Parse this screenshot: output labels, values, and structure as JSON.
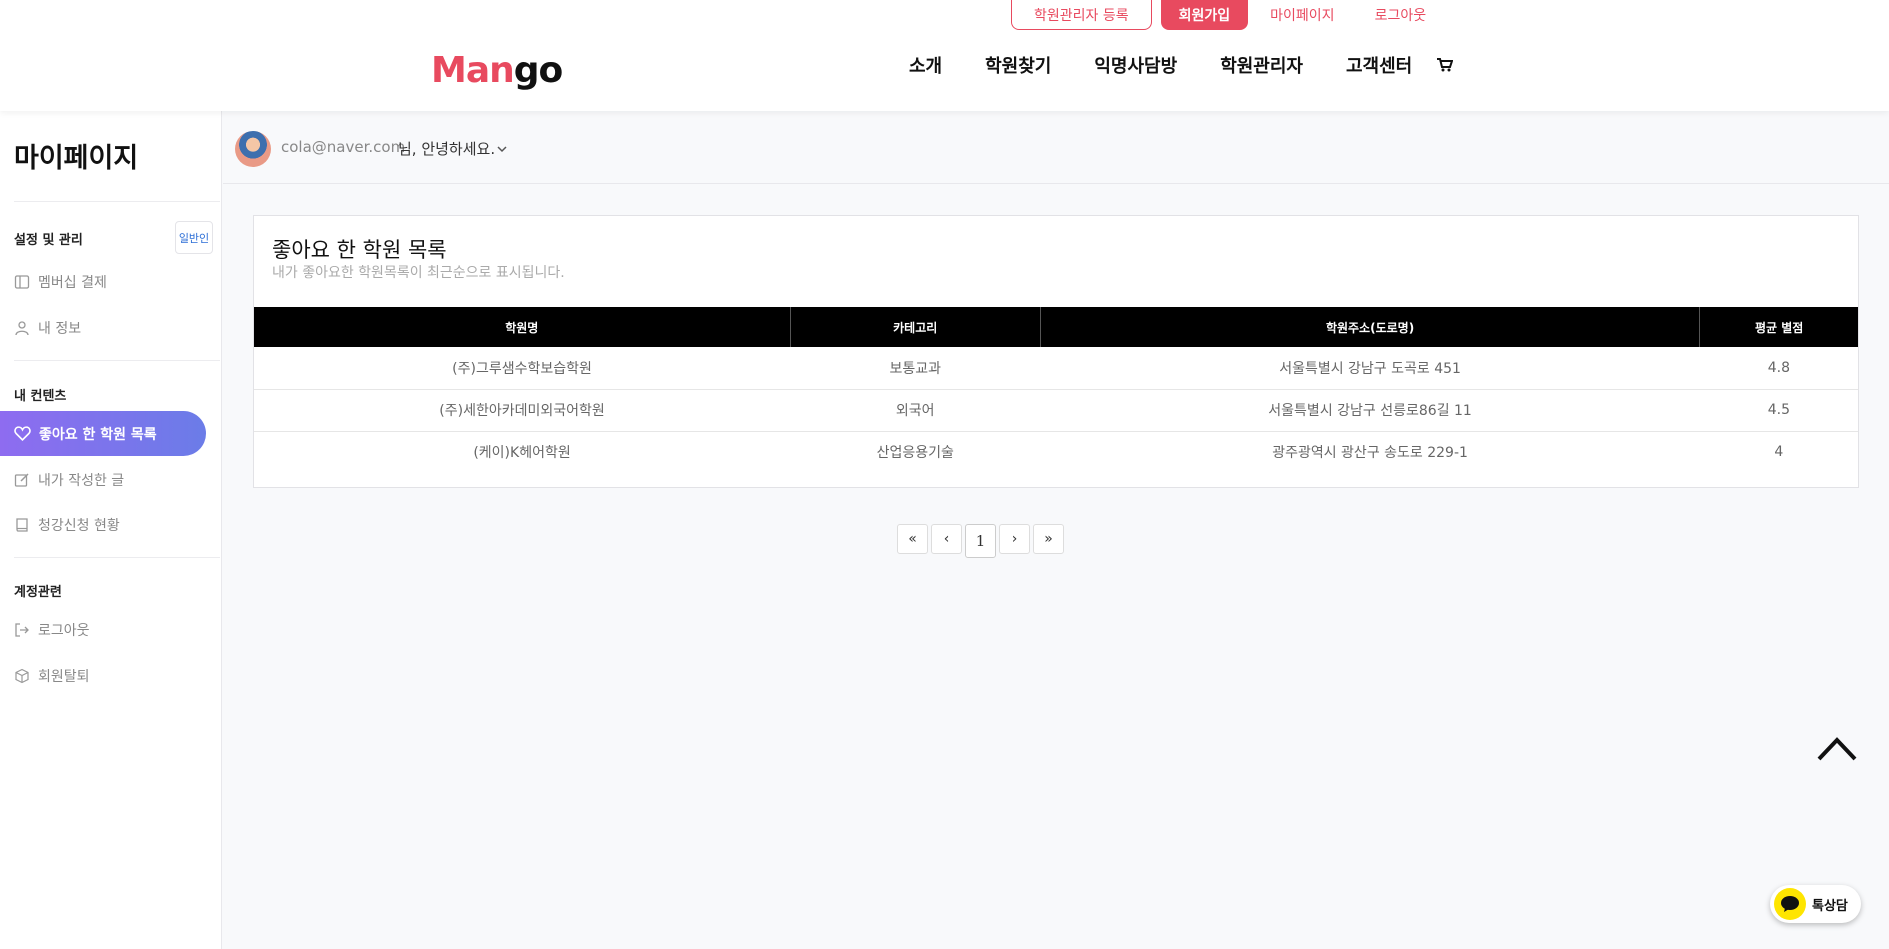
{
  "brand": {
    "logo_part1": "Man",
    "logo_part2": "go"
  },
  "topbar": {
    "register_academy": "학원관리자 등록",
    "signup": "회원가입",
    "mypage": "마이페이지",
    "logout": "로그아웃"
  },
  "nav": {
    "items": [
      "소개",
      "학원찾기",
      "익명사담방",
      "학원관리자",
      "고객센터"
    ]
  },
  "sidebar": {
    "title": "마이페이지",
    "section_settings": "설정 및 관리",
    "badge": "일반인",
    "membership": "멤버십 결제",
    "my_info": "내 정보",
    "section_content": "내 컨텐츠",
    "liked": "좋아요 한 학원 목록",
    "my_posts": "내가 작성한 글",
    "enrollment": "청강신청 현황",
    "section_account": "계정관련",
    "logout": "로그아웃",
    "withdraw": "회원탈퇴"
  },
  "userbar": {
    "email": "cola@naver.com",
    "greeting": "님, 안녕하세요."
  },
  "card": {
    "title": "좋아요 한 학원 목록",
    "subtitle": "내가 좋아요한 학원목록이 최근순으로 표시됩니다.",
    "headers": [
      "학원명",
      "카테고리",
      "학원주소(도로명)",
      "평균 별점"
    ],
    "rows": [
      [
        "(주)그루샘수학보습학원",
        "보통교과",
        "서울특별시 강남구 도곡로 451",
        "4.8"
      ],
      [
        "(주)세한아카데미외국어학원",
        "외국어",
        "서울특별시 강남구 선릉로86길 11",
        "4.5"
      ],
      [
        "(케이)K헤어학원",
        "산업응용기술",
        "광주광역시 광산구 송도로 229-1",
        "4"
      ]
    ]
  },
  "pagination": {
    "first": "«",
    "prev": "‹",
    "current": "1",
    "next": "›",
    "last": "»"
  },
  "chat": {
    "label": "톡상담"
  },
  "colors": {
    "brand": "#e84a5f",
    "active_gradient_start": "#8e6cf0",
    "active_gradient_end": "#6b7ce8",
    "kakao": "#fee500"
  }
}
